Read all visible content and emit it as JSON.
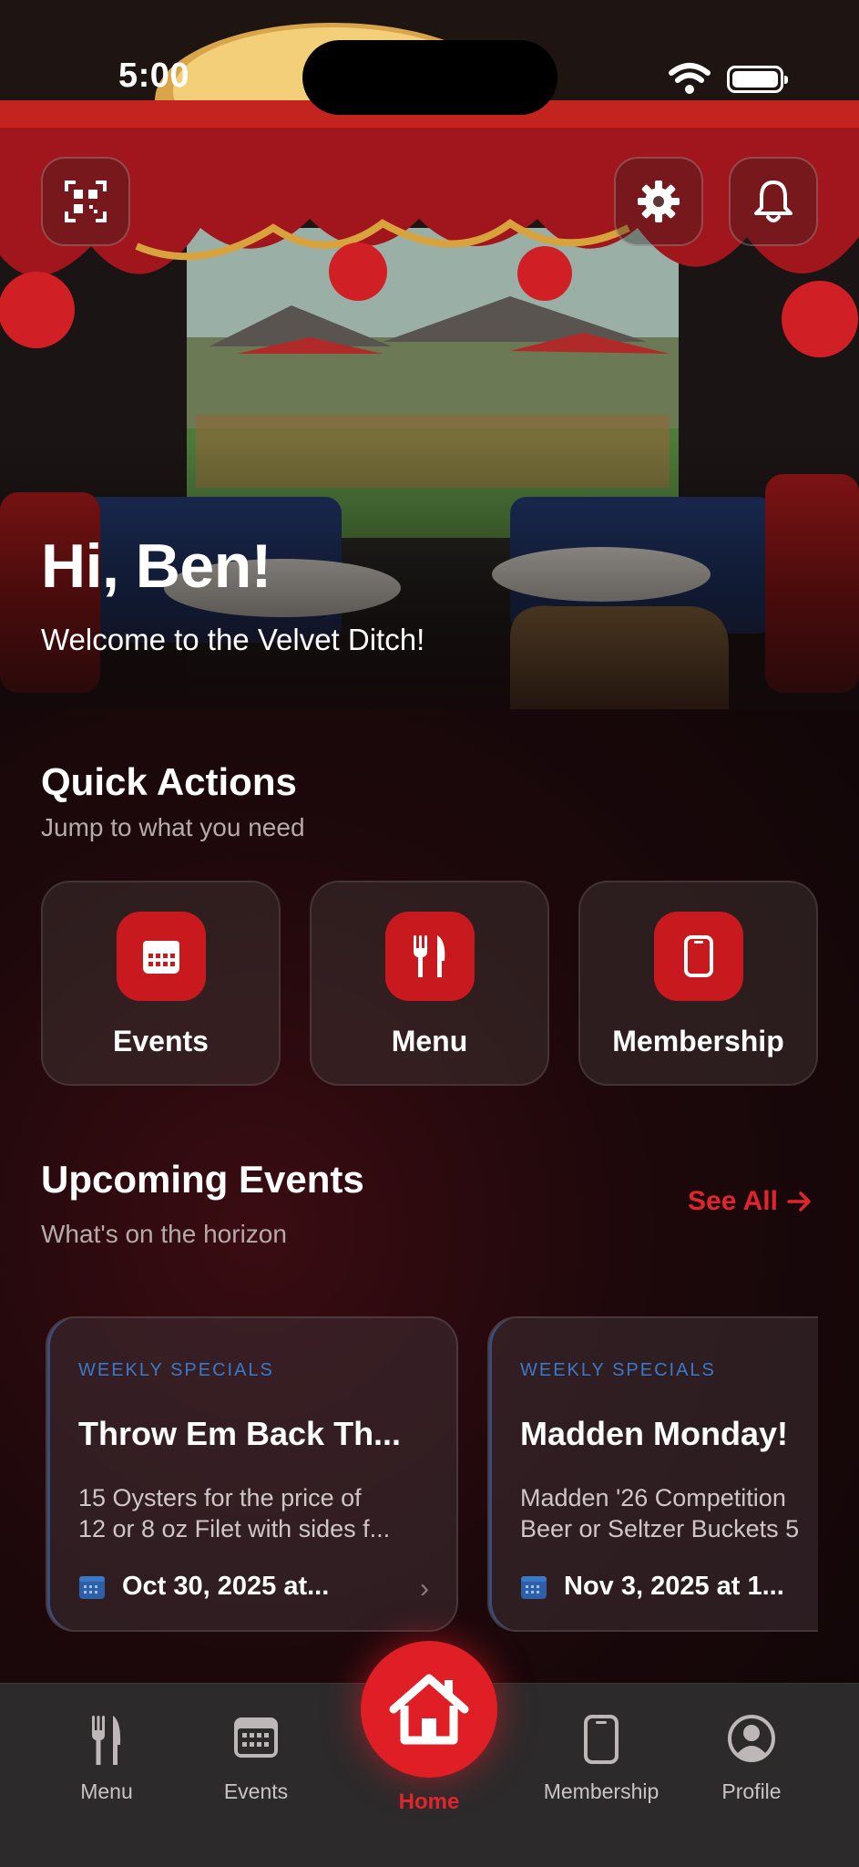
{
  "status": {
    "time": "5:00"
  },
  "hero": {
    "greeting": "Hi, Ben!",
    "welcome": "Welcome to the Velvet Ditch!",
    "icons": [
      "qr-code-icon",
      "gear-icon",
      "bell-icon"
    ]
  },
  "quick_actions": {
    "title": "Quick Actions",
    "subtitle": "Jump to what you need",
    "items": [
      {
        "label": "Events",
        "icon": "calendar-icon"
      },
      {
        "label": "Menu",
        "icon": "fork-knife-icon"
      },
      {
        "label": "Membership",
        "icon": "phone-card-icon"
      }
    ]
  },
  "upcoming": {
    "title": "Upcoming Events",
    "subtitle": "What's on the horizon",
    "see_all": "See All",
    "events": [
      {
        "category": "WEEKLY SPECIALS",
        "title": "Throw Em Back Th...",
        "desc_line1": "15 Oysters for the price of",
        "desc_line2": "12 or 8 oz Filet with sides f...",
        "date": "Oct 30, 2025 at..."
      },
      {
        "category": "WEEKLY SPECIALS",
        "title": "Madden Monday!",
        "desc_line1": "Madden '26 Competition",
        "desc_line2": "Beer or Seltzer Buckets 5",
        "date": "Nov 3, 2025 at 1..."
      }
    ]
  },
  "tabbar": {
    "items": [
      {
        "label": "Menu",
        "icon": "fork-knife-icon"
      },
      {
        "label": "Events",
        "icon": "calendar-icon"
      },
      {
        "label": "Home",
        "icon": "house-icon",
        "active": true
      },
      {
        "label": "Membership",
        "icon": "phone-card-icon"
      },
      {
        "label": "Profile",
        "icon": "profile-icon"
      }
    ]
  },
  "colors": {
    "accent": "#e01e25",
    "category": "#3a78c8",
    "background": "#120708"
  }
}
